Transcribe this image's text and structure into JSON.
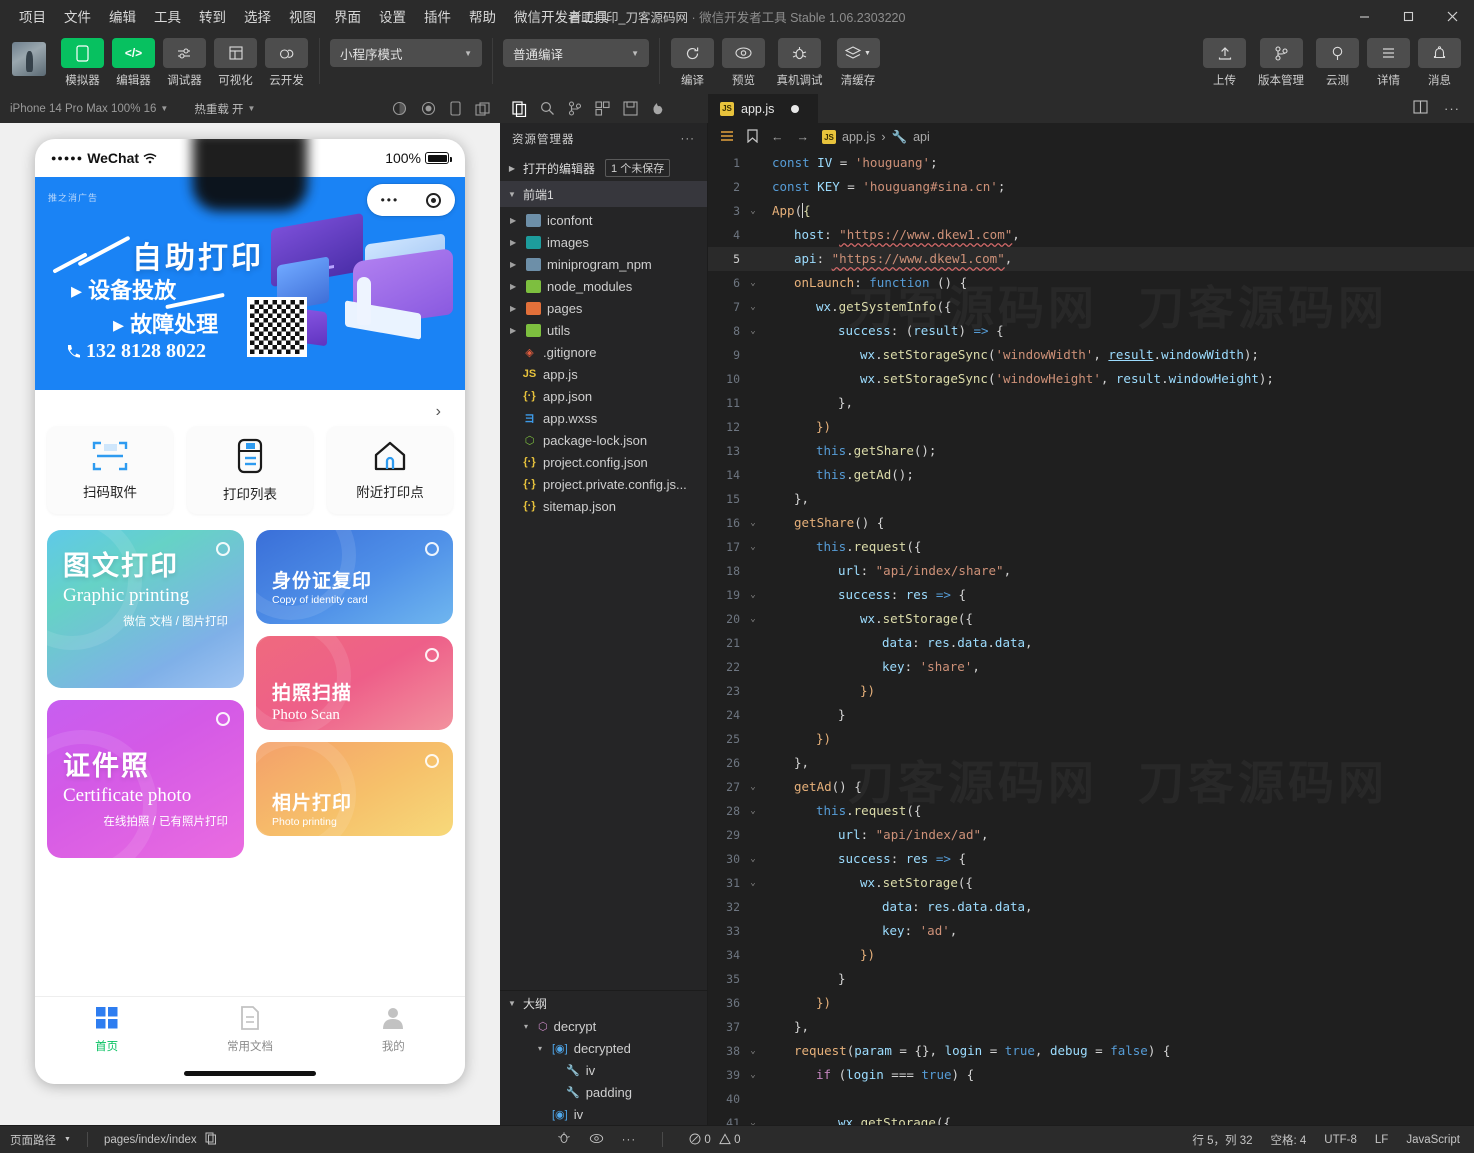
{
  "window": {
    "title_main": "自助打印_刀客源码网",
    "title_sep": " · ",
    "title_sub": "微信开发者工具 Stable 1.06.2303220",
    "minimize": "—",
    "maximize": "▢",
    "close": "✕"
  },
  "menubar": [
    "项目",
    "文件",
    "编辑",
    "工具",
    "转到",
    "选择",
    "视图",
    "界面",
    "设置",
    "插件",
    "帮助",
    "微信开发者工具"
  ],
  "toolbar": {
    "left_buttons": [
      {
        "label": "模拟器",
        "icon": "phone-icon",
        "accent": true
      },
      {
        "label": "编辑器",
        "icon": "code-icon",
        "accent": true
      },
      {
        "label": "调试器",
        "icon": "debugger-icon",
        "accent": false
      },
      {
        "label": "可视化",
        "icon": "grid-icon",
        "accent": false
      },
      {
        "label": "云开发",
        "icon": "cloud-icon",
        "accent": false
      }
    ],
    "mode_dropdown": "小程序模式",
    "compile_dropdown": "普通编译",
    "mid_buttons": [
      {
        "label": "编译",
        "icon": "refresh-icon"
      },
      {
        "label": "预览",
        "icon": "eye-icon"
      },
      {
        "label": "真机调试",
        "icon": "bug-icon"
      },
      {
        "label": "清缓存",
        "icon": "layers-icon"
      }
    ],
    "right_buttons": [
      {
        "label": "上传",
        "icon": "upload-icon"
      },
      {
        "label": "版本管理",
        "icon": "branch-icon"
      },
      {
        "label": "云测",
        "icon": "cloud-test-icon"
      },
      {
        "label": "详情",
        "icon": "details-icon"
      },
      {
        "label": "消息",
        "icon": "bell-icon"
      }
    ]
  },
  "sim_toolbar": {
    "device": "iPhone 14 Pro Max 100% 16",
    "hot_reload": "热重载 开"
  },
  "explorer": {
    "title": "资源管理器",
    "more": "···",
    "open_editors_label": "打开的编辑器",
    "unsaved_badge": "1 个未保存",
    "project_name": "前端1",
    "tree": [
      {
        "name": "iconfont",
        "type": "folder",
        "color": "blue"
      },
      {
        "name": "images",
        "type": "folder",
        "color": "teal"
      },
      {
        "name": "miniprogram_npm",
        "type": "folder",
        "color": "blue"
      },
      {
        "name": "node_modules",
        "type": "folder",
        "color": "green"
      },
      {
        "name": "pages",
        "type": "folder",
        "color": "orange"
      },
      {
        "name": "utils",
        "type": "folder",
        "color": "green"
      },
      {
        "name": ".gitignore",
        "type": "file",
        "glyph": "◈",
        "gcolor": "#e05c3e"
      },
      {
        "name": "app.js",
        "type": "file",
        "glyph": "JS",
        "gcolor": "#e8c33c"
      },
      {
        "name": "app.json",
        "type": "file",
        "glyph": "{·}",
        "gcolor": "#e8c33c"
      },
      {
        "name": "app.wxss",
        "type": "file",
        "glyph": "ヨ",
        "gcolor": "#3d9ae8"
      },
      {
        "name": "package-lock.json",
        "type": "file",
        "glyph": "⬡",
        "gcolor": "#7dbf3f"
      },
      {
        "name": "project.config.json",
        "type": "file",
        "glyph": "{·}",
        "gcolor": "#e8c33c"
      },
      {
        "name": "project.private.config.js...",
        "type": "file",
        "glyph": "{·}",
        "gcolor": "#e8c33c"
      },
      {
        "name": "sitemap.json",
        "type": "file",
        "glyph": "{·}",
        "gcolor": "#e8c33c"
      }
    ],
    "outline_title": "大纲",
    "outline": [
      {
        "name": "decrypt",
        "glyph": "⬡",
        "gcolor": "#c586c0",
        "indent": 1,
        "chev": "▾"
      },
      {
        "name": "decrypted",
        "glyph": "[◉]",
        "gcolor": "#4fa7ea",
        "indent": 2,
        "chev": "▾"
      },
      {
        "name": "iv",
        "glyph": "🔧",
        "gcolor": "#cfcfcf",
        "indent": 3,
        "chev": ""
      },
      {
        "name": "padding",
        "glyph": "🔧",
        "gcolor": "#cfcfcf",
        "indent": 3,
        "chev": ""
      },
      {
        "name": "iv",
        "glyph": "[◉]",
        "gcolor": "#4fa7ea",
        "indent": 2,
        "chev": ""
      }
    ]
  },
  "editor": {
    "tab_name": "app.js",
    "tab_icon": "JS",
    "dirty": true,
    "breadcrumb": [
      "app.js",
      "api"
    ],
    "lines": [
      {
        "n": 1,
        "fold": "",
        "html": "<span class=\"k\">const</span> <span class=\"v\">IV</span> <span class=\"p\">=</span> <span class=\"s\">'houguang'</span><span class=\"p\">;</span>",
        "indent": 0
      },
      {
        "n": 2,
        "fold": "",
        "html": "<span class=\"k\">const</span> <span class=\"v\">KEY</span> <span class=\"p\">=</span> <span class=\"s\">'houguang#sina.cn'</span><span class=\"p\">;</span>",
        "indent": 0
      },
      {
        "n": 3,
        "fold": "v",
        "html": "<span class=\"o\">App</span><span class=\"p\">(</span><span class=\"cur-caret\" style=\"color:#dcdcaa\">{</span>",
        "indent": 0
      },
      {
        "n": 4,
        "fold": "",
        "html": "<span class=\"v\">host</span><span class=\"p\">:</span> <span class=\"s u\">\"https://www.dkew1.com\"</span><span class=\"p\">,</span>",
        "indent": 1
      },
      {
        "n": 5,
        "fold": "",
        "html": "<span class=\"v\">api</span><span class=\"p\">:</span> <span class=\"s u\">\"https://www.dkew1.com\"</span><span class=\"p\">,</span>",
        "indent": 1,
        "current": true
      },
      {
        "n": 6,
        "fold": "v",
        "html": "<span class=\"o\">onLaunch</span><span class=\"p\">:</span> <span class=\"k\">function</span> <span class=\"p\">() {</span>",
        "indent": 1
      },
      {
        "n": 7,
        "fold": "v",
        "html": "<span class=\"v\">wx</span><span class=\"p\">.</span><span class=\"f\">getSystemInfo</span><span class=\"p\">({</span>",
        "indent": 2
      },
      {
        "n": 8,
        "fold": "v",
        "html": "<span class=\"v\">success</span><span class=\"p\">:</span> <span class=\"p\">(</span><span class=\"v\">result</span><span class=\"p\">)</span> <span class=\"k\">=&gt;</span> <span class=\"p\">{</span>",
        "indent": 3
      },
      {
        "n": 9,
        "fold": "",
        "html": "<span class=\"v\">wx</span><span class=\"p\">.</span><span class=\"f\">setStorageSync</span><span class=\"p\">(</span><span class=\"s\">'windowWidth'</span><span class=\"p\">,</span> <span class=\"v ul\">result</span><span class=\"p\">.</span><span class=\"v\">windowWidth</span><span class=\"p\">);</span>",
        "indent": 4
      },
      {
        "n": 10,
        "fold": "",
        "html": "<span class=\"v\">wx</span><span class=\"p\">.</span><span class=\"f\">setStorageSync</span><span class=\"p\">(</span><span class=\"s\">'windowHeight'</span><span class=\"p\">,</span> <span class=\"v\">result</span><span class=\"p\">.</span><span class=\"v\">windowHeight</span><span class=\"p\">);</span>",
        "indent": 4
      },
      {
        "n": 11,
        "fold": "",
        "html": "<span class=\"p\">},</span>",
        "indent": 3
      },
      {
        "n": 12,
        "fold": "",
        "html": "<span class=\"o\">})</span>",
        "indent": 2
      },
      {
        "n": 13,
        "fold": "",
        "html": "<span class=\"k\">this</span><span class=\"p\">.</span><span class=\"f\">getShare</span><span class=\"p\">();</span>",
        "indent": 2
      },
      {
        "n": 14,
        "fold": "",
        "html": "<span class=\"k\">this</span><span class=\"p\">.</span><span class=\"f\">getAd</span><span class=\"p\">();</span>",
        "indent": 2
      },
      {
        "n": 15,
        "fold": "",
        "html": "<span class=\"p\">},</span>",
        "indent": 1
      },
      {
        "n": 16,
        "fold": "v",
        "html": "<span class=\"o\">getShare</span><span class=\"p\">() {</span>",
        "indent": 1
      },
      {
        "n": 17,
        "fold": "v",
        "html": "<span class=\"k\">this</span><span class=\"p\">.</span><span class=\"f\">request</span><span class=\"p\">({</span>",
        "indent": 2
      },
      {
        "n": 18,
        "fold": "",
        "html": "<span class=\"v\">url</span><span class=\"p\">:</span> <span class=\"s\">\"api/index/share\"</span><span class=\"p\">,</span>",
        "indent": 3
      },
      {
        "n": 19,
        "fold": "v",
        "html": "<span class=\"v\">success</span><span class=\"p\">:</span> <span class=\"v\">res</span> <span class=\"k\">=&gt;</span> <span class=\"p\">{</span>",
        "indent": 3
      },
      {
        "n": 20,
        "fold": "v",
        "html": "<span class=\"v\">wx</span><span class=\"p\">.</span><span class=\"f\">setStorage</span><span class=\"p\">({</span>",
        "indent": 4
      },
      {
        "n": 21,
        "fold": "",
        "html": "<span class=\"v\">data</span><span class=\"p\">:</span> <span class=\"v\">res</span><span class=\"p\">.</span><span class=\"v\">data</span><span class=\"p\">.</span><span class=\"v\">data</span><span class=\"p\">,</span>",
        "indent": 5
      },
      {
        "n": 22,
        "fold": "",
        "html": "<span class=\"v\">key</span><span class=\"p\">:</span> <span class=\"s\">'share'</span><span class=\"p\">,</span>",
        "indent": 5
      },
      {
        "n": 23,
        "fold": "",
        "html": "<span class=\"o\">})</span>",
        "indent": 4
      },
      {
        "n": 24,
        "fold": "",
        "html": "<span class=\"p\">}</span>",
        "indent": 3
      },
      {
        "n": 25,
        "fold": "",
        "html": "<span class=\"o\">})</span>",
        "indent": 2
      },
      {
        "n": 26,
        "fold": "",
        "html": "<span class=\"p\">},</span>",
        "indent": 1
      },
      {
        "n": 27,
        "fold": "v",
        "html": "<span class=\"o\">getAd</span><span class=\"p\">() {</span>",
        "indent": 1
      },
      {
        "n": 28,
        "fold": "v",
        "html": "<span class=\"k\">this</span><span class=\"p\">.</span><span class=\"f\">request</span><span class=\"p\">({</span>",
        "indent": 2
      },
      {
        "n": 29,
        "fold": "",
        "html": "<span class=\"v\">url</span><span class=\"p\">:</span> <span class=\"s\">\"api/index/ad\"</span><span class=\"p\">,</span>",
        "indent": 3
      },
      {
        "n": 30,
        "fold": "v",
        "html": "<span class=\"v\">success</span><span class=\"p\">:</span> <span class=\"v\">res</span> <span class=\"k\">=&gt;</span> <span class=\"p\">{</span>",
        "indent": 3
      },
      {
        "n": 31,
        "fold": "v",
        "html": "<span class=\"v\">wx</span><span class=\"p\">.</span><span class=\"f\">setStorage</span><span class=\"p\">({</span>",
        "indent": 4
      },
      {
        "n": 32,
        "fold": "",
        "html": "<span class=\"v\">data</span><span class=\"p\">:</span> <span class=\"v\">res</span><span class=\"p\">.</span><span class=\"v\">data</span><span class=\"p\">.</span><span class=\"v\">data</span><span class=\"p\">,</span>",
        "indent": 5
      },
      {
        "n": 33,
        "fold": "",
        "html": "<span class=\"v\">key</span><span class=\"p\">:</span> <span class=\"s\">'ad'</span><span class=\"p\">,</span>",
        "indent": 5
      },
      {
        "n": 34,
        "fold": "",
        "html": "<span class=\"o\">})</span>",
        "indent": 4
      },
      {
        "n": 35,
        "fold": "",
        "html": "<span class=\"p\">}</span>",
        "indent": 3
      },
      {
        "n": 36,
        "fold": "",
        "html": "<span class=\"o\">})</span>",
        "indent": 2
      },
      {
        "n": 37,
        "fold": "",
        "html": "<span class=\"p\">},</span>",
        "indent": 1
      },
      {
        "n": 38,
        "fold": "v",
        "html": "<span class=\"o\">request</span><span class=\"p\">(</span><span class=\"v\">param</span> <span class=\"p\">= {},</span> <span class=\"v\">login</span> <span class=\"p\">=</span> <span class=\"k\">true</span><span class=\"p\">,</span> <span class=\"v\">debug</span> <span class=\"p\">=</span> <span class=\"k\">false</span><span class=\"p\">) {</span>",
        "indent": 1
      },
      {
        "n": 39,
        "fold": "v",
        "html": "<span class=\"kc\">if</span> <span class=\"p\">(</span><span class=\"v\">login</span> <span class=\"p\">===</span> <span class=\"k\">true</span><span class=\"p\">) {</span>",
        "indent": 2
      },
      {
        "n": 40,
        "fold": "",
        "html": "",
        "indent": 0
      },
      {
        "n": 41,
        "fold": "v",
        "html": "<span class=\"v\">wx</span><span class=\"p\">.</span><span class=\"f\">getStorage</span><span class=\"p\">({</span>",
        "indent": 3
      }
    ]
  },
  "simulator": {
    "statusbar": {
      "carrier": "WeChat",
      "dots": "●●●●●",
      "battery": "100%"
    },
    "capsule": {
      "dots": "•••",
      "target": "target-icon"
    },
    "banner": {
      "ad_tag": "推之消广告",
      "title": "自助打印",
      "line1": "设备投放",
      "line2": "故障处理",
      "phone": "132 8128 8022"
    },
    "shortcuts": [
      {
        "label": "扫码取件",
        "icon": "scan-icon"
      },
      {
        "label": "打印列表",
        "icon": "printer-list-icon"
      },
      {
        "label": "附近打印点",
        "icon": "nearby-home-icon"
      }
    ],
    "cards": [
      {
        "id": "graphic",
        "cn": "图文打印",
        "en": "Graphic printing",
        "sub": "微信 文档 / 图片打印"
      },
      {
        "id": "certificate",
        "cn": "证件照",
        "en": "Certificate photo",
        "sub": "在线拍照 / 已有照片打印"
      },
      {
        "id": "idcard",
        "cn": "身份证复印",
        "en": "Copy of identity card",
        "sub": ""
      },
      {
        "id": "photoscan",
        "cn": "拍照扫描",
        "en": "Photo Scan",
        "sub": ""
      },
      {
        "id": "photoprint",
        "cn": "相片打印",
        "en": "Photo printing",
        "sub": ""
      }
    ],
    "tabbar": [
      {
        "label": "首页",
        "icon": "grid-home-icon",
        "active": true
      },
      {
        "label": "常用文档",
        "icon": "document-icon",
        "active": false
      },
      {
        "label": "我的",
        "icon": "user-icon",
        "active": false
      }
    ]
  },
  "statusbar": {
    "page_path_label": "页面路径",
    "page_path": "pages/index/index",
    "copy_icon": "copy-icon",
    "errors": "0",
    "warnings": "0",
    "cursor": "行 5，列 32",
    "spaces": "空格: 4",
    "encoding": "UTF-8",
    "eol": "LF",
    "language": "JavaScript"
  },
  "colors": {
    "accent_green": "#07c160",
    "banner_blue": "#1a83f5",
    "editor_bg": "#1f1f1f",
    "chrome_bg": "#2b2b2b"
  }
}
